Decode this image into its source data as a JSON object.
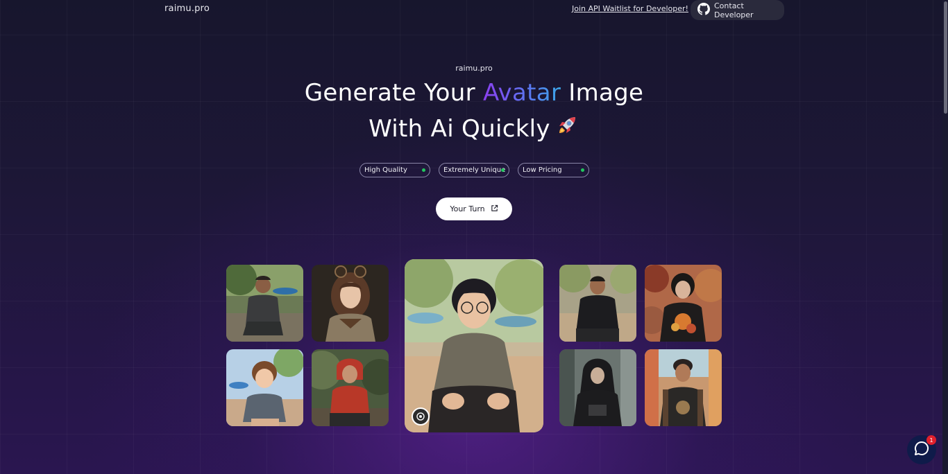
{
  "header": {
    "brand": "raimu.pro",
    "waitlist_link": "Join API Waitlist for Developer!",
    "contact_button": "Contact Developer"
  },
  "hero": {
    "eyebrow": "raimu.pro",
    "headline_part1": "Generate Your ",
    "headline_highlight": "Avatar",
    "headline_part2": " Image",
    "headline_line2": "With Ai Quickly",
    "badges": [
      "High Quality",
      "Extremely Unique",
      "Low Pricing"
    ],
    "cta_label": "Your Turn"
  },
  "colors": {
    "accent_gradient_start": "#8b3ff0",
    "accent_gradient_end": "#3ba6e8",
    "badge_dot": "#22c55e",
    "notification": "#e0202c"
  },
  "gallery": {
    "tiles": [
      {
        "name": "avatar-man-sitting-market"
      },
      {
        "name": "avatar-girl-anime-style"
      },
      {
        "name": "avatar-boy-anime-sitting"
      },
      {
        "name": "avatar-boy-red-hoodie"
      },
      {
        "name": "avatar-boy-glasses-featured"
      },
      {
        "name": "avatar-boy-black-shirt"
      },
      {
        "name": "avatar-boy-floral-shirt"
      },
      {
        "name": "avatar-boy-black-hoodie"
      },
      {
        "name": "avatar-boy-backpack"
      }
    ]
  },
  "chat": {
    "unread_count": "1",
    "icon": "chat-bubble-icon"
  }
}
